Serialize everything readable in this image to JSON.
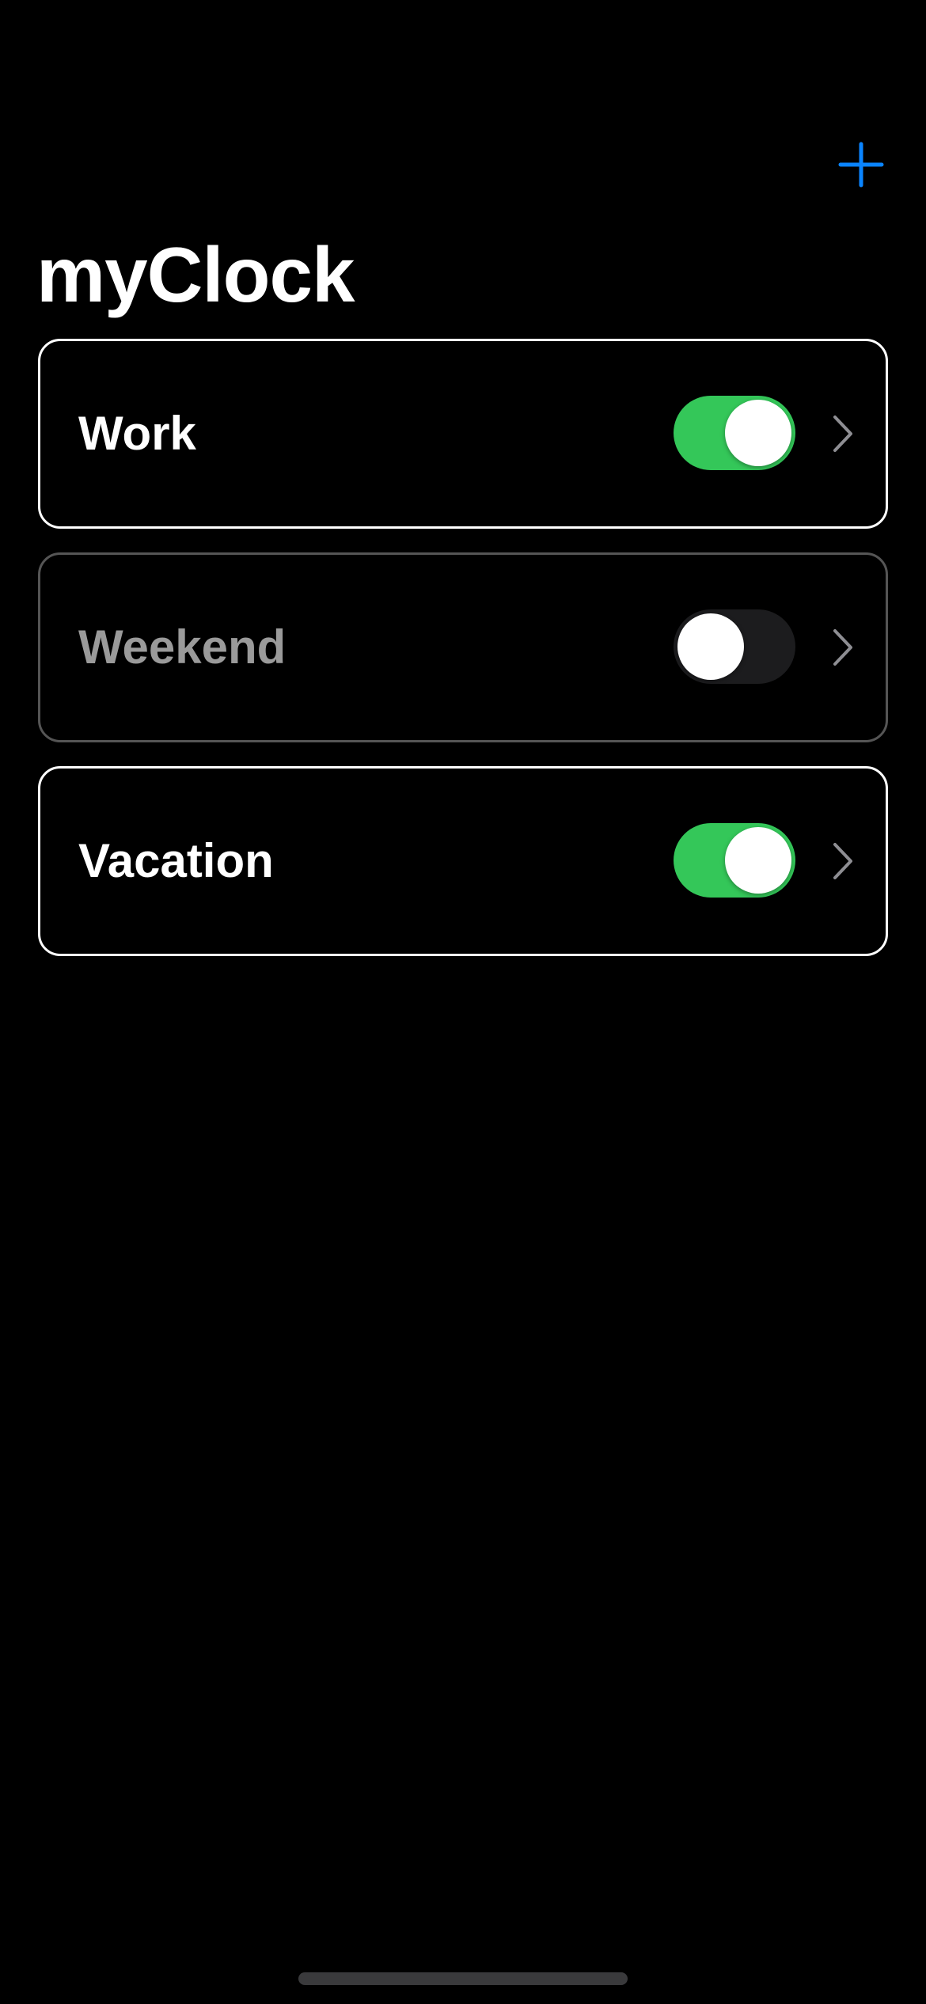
{
  "header": {
    "title": "myClock",
    "add_icon": "plus-icon"
  },
  "colors": {
    "accent": "#0a84ff",
    "toggle_on": "#34c759",
    "toggle_off": "#1c1c1e",
    "background": "#000000"
  },
  "schedules": [
    {
      "name": "Work",
      "enabled": true
    },
    {
      "name": "Weekend",
      "enabled": false
    },
    {
      "name": "Vacation",
      "enabled": true
    }
  ],
  "icons": {
    "chevron": "chevron-right-icon"
  }
}
